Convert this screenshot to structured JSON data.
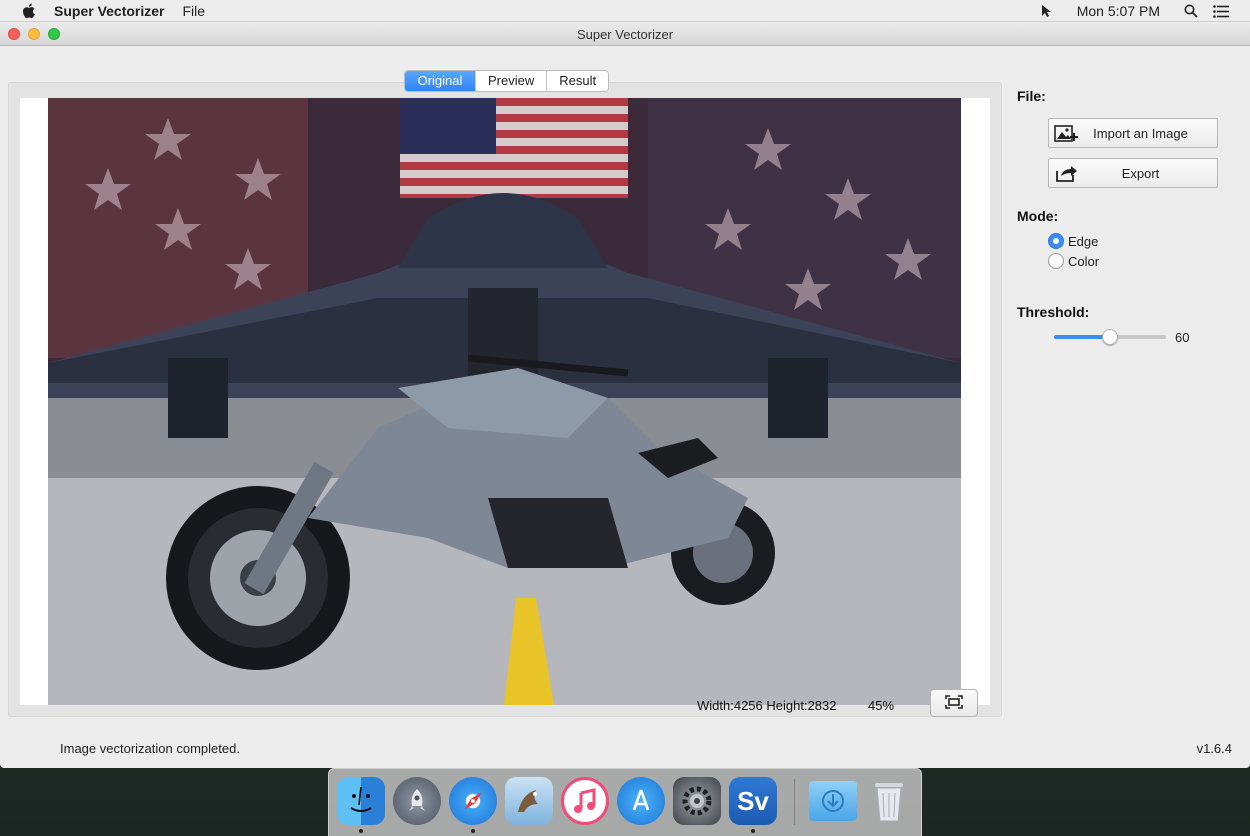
{
  "menubar": {
    "app_name": "Super Vectorizer",
    "menu_file": "File",
    "clock": "Mon 5:07 PM"
  },
  "window": {
    "title": "Super Vectorizer"
  },
  "tabs": [
    {
      "label": "Original",
      "active": true
    },
    {
      "label": "Preview",
      "active": false
    },
    {
      "label": "Result",
      "active": false
    }
  ],
  "image": {
    "dimensions": "Width:4256 Height:2832",
    "zoom": "45%"
  },
  "sidebar": {
    "file_title": "File:",
    "import_label": "Import an Image",
    "export_label": "Export",
    "mode_title": "Mode:",
    "mode_options": [
      {
        "label": "Edge",
        "checked": true
      },
      {
        "label": "Color",
        "checked": false
      }
    ],
    "threshold_title": "Threshold:",
    "threshold_value": "60",
    "threshold_fraction": 0.5
  },
  "status": {
    "message": "Image vectorization completed.",
    "version": "v1.6.4"
  },
  "dock": {
    "items": [
      "finder-icon",
      "launchpad-icon",
      "safari-icon",
      "mail-icon",
      "itunes-icon",
      "app-store-icon",
      "system-preferences-icon",
      "super-vectorizer-icon",
      "downloads-folder-icon",
      "trash-icon"
    ],
    "sv_label": "Sv"
  },
  "colors": {
    "accent": "#3b8df5",
    "close": "#fc605c",
    "minimize": "#fdbc40",
    "maximize": "#34c84a"
  }
}
